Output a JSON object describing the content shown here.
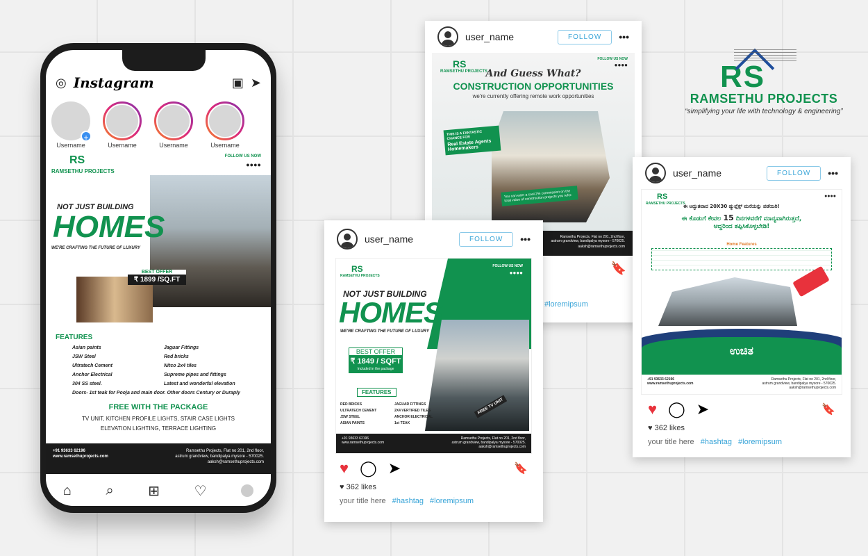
{
  "brand": {
    "name": "RAMSETHU PROJECTS",
    "tagline": "“simplifying your life with technology & engineering”",
    "logo_letters": "RS",
    "green": "#11924f",
    "blue": "#1f4e9c"
  },
  "phone": {
    "app_title": "Instagram",
    "stories": [
      "Username",
      "Username",
      "Username",
      "Username"
    ],
    "post": {
      "follow_label": "FOLLOW US NOW",
      "headline_small": "NOT JUST BUILDING",
      "headline_big": "HOMES",
      "subline": "WE'RE CRAFTING THE FUTURE OF LUXURY",
      "offer_label": "BEST OFFER",
      "price": "₹ 1899 /SQ.FT",
      "features_title": "FEATURES",
      "features_left": [
        "Asian paints",
        "JSW Steel",
        "Ultratech Cement",
        "Anchor Electrical",
        "304 SS steel."
      ],
      "features_right": [
        "Jaguar Fittings",
        "Red bricks",
        "Nitco 2x4 tiles",
        "Supreme pipes and fittings",
        "Latest and wonderful elevation"
      ],
      "features_extra": "Doors- 1st teak for Pooja and main door. Other doors Century or Duraply",
      "free_title": "FREE WITH THE PACKAGE",
      "free_line1": "TV UNIT, KITCHEN PROFILE LIGHTS, STAIR CASE LIGHTS",
      "free_line2": "ELEVATION LIGHTING, TERRACE LIGHTING",
      "phone_no": "+91 93633 62196",
      "website": "www.ramsethuprojects.com",
      "address1": "Ramsethu Projects, Flat no 201, 2nd floor,",
      "address2": "astrum grandview, bandipalya mysore - 570025.",
      "email": "aaksh@ramsethuprojects.com"
    }
  },
  "card_center": {
    "user": "user_name",
    "follow": "FOLLOW",
    "follow_us": "FOLLOW US NOW",
    "headline_small": "NOT JUST BUILDING",
    "headline_big": "HOMES",
    "subline": "WE'RE CRAFTING THE FUTURE OF LUXURY",
    "offer_label": "BEST OFFER",
    "price": "₹ 1849 / SQFT",
    "included": "Included in the package",
    "tv_badge": "FREE TV UNIT",
    "features_title": "FEATURES",
    "features_left": [
      "RED BRICKS",
      "ULTRATECH CEMENT",
      "JSW STEEL",
      "ASIAN PAINTS"
    ],
    "features_right": [
      "JAGUAR FITTINGS",
      "2X4 VERTIFIED TILES",
      "ANCHOR ELECTRICAL",
      "1st TEAK"
    ],
    "phone_no": "+91 93633 62196",
    "website": "www.ramsethuprojects.com",
    "address1": "Ramsethu Projects, Flat no 201, 2nd floor,",
    "address2": "astrum grandview, bandipalya mysore - 570025.",
    "email": "aaksh@ramsethuprojects.com",
    "likes": "362 likes",
    "caption": "your title here",
    "tag1": "#hashtag",
    "tag2": "#loremipsum"
  },
  "card_back": {
    "user": "user_name",
    "follow": "FOLLOW",
    "follow_us": "FOLLOW US NOW",
    "line1": "And Guess What?",
    "line2": "CONSTRUCTION OPPORTUNITIES",
    "line3": "we're currently offering remote work opportunities",
    "chance": "THIS IS A FANTASTIC CHANCE FOR",
    "aud1": "Real Estate Agents",
    "aud2": "Homemakers",
    "commission": "You can earn a cool 2% commission on the total value of construction projects you refer.",
    "address1": "Ramsethu Projects, Flat no 201, 2nd floor,",
    "address2": "astrum grandview, bandipalya mysore - 570025.",
    "email": "aaksh@ramsethuprojects.com",
    "tag": "#loremipsum"
  },
  "card_right": {
    "user": "user_name",
    "follow": "FOLLOW",
    "kn_line1": "ಈ ಅದ್ಭುತವಾದ 20X30 ಡ್ಯುಪ್ಲೆಕ್ಸ್ ಮನೆಯನ್ನು ಪಡೆಯಿರಿ!",
    "kn_line2a": "ಈ ಕೊಡುಗೆ ಕೇವಲ ",
    "kn_15": "15",
    "kn_line2b": " ದಿನಗಳವರೆಗೆ ಮಾನ್ಯವಾಗಿರುತ್ತದೆ,",
    "kn_line3": "ಆದ್ದರಿಂದ ತಪ್ಪಿಸಿಕೊಳ್ಳಬೇಡಿ!",
    "home_features": "Home Features",
    "uchita": "ಉಚಿತ",
    "phone_no": "+91 93633 62196",
    "website": "www.ramsethuprojects.com",
    "address1": "Ramsethu Projects, Flat no 201, 2nd floor,",
    "address2": "astrum grandview, bandipalya mysore - 570025.",
    "email": "aaksh@ramsethuprojects.com",
    "likes": "362 likes",
    "caption": "your title here",
    "tag1": "#hashtag",
    "tag2": "#loremipsum"
  }
}
